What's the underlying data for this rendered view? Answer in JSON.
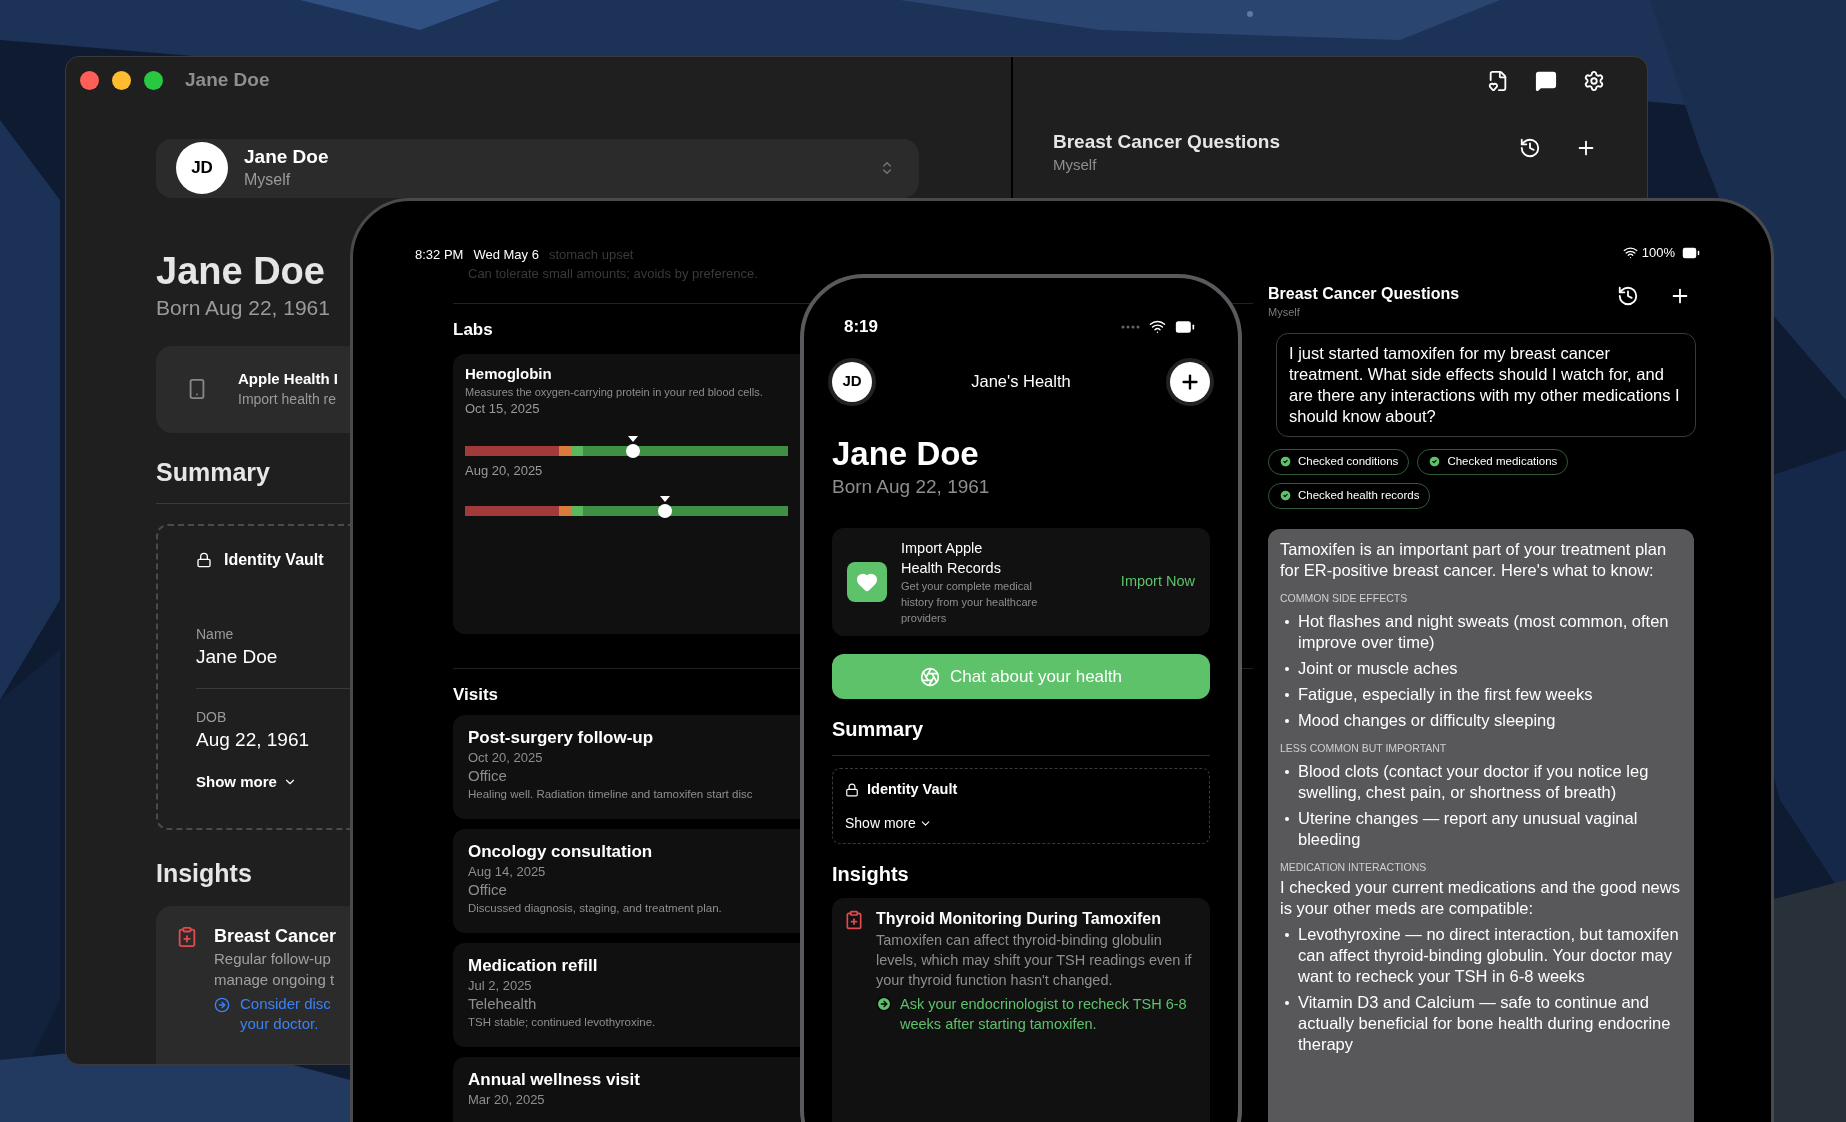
{
  "desktop_window": {
    "title": "Jane Doe",
    "profile": {
      "initials": "JD",
      "name": "Jane Doe",
      "relation": "Myself"
    },
    "name": "Jane Doe",
    "born": "Born Aug 22, 1961",
    "import_card": {
      "title": "Apple Health I",
      "subtitle": "Import health re"
    },
    "summary_heading": "Summary",
    "identity_vault": {
      "title": "Identity Vault",
      "fields": [
        {
          "label": "Name",
          "value": "Jane Doe"
        },
        {
          "label": "DOB",
          "value": "Aug 22, 1961"
        }
      ],
      "show_more": "Show more"
    },
    "insights_heading": "Insights",
    "insight": {
      "title": "Breast Cancer",
      "body_lines": [
        "Regular follow-up",
        "manage ongoing t"
      ],
      "action_lines": [
        "Consider disc",
        "your doctor."
      ]
    },
    "chat": {
      "title": "Breast Cancer Questions",
      "subtitle": "Myself"
    }
  },
  "tablet": {
    "status": {
      "time": "8:32 PM",
      "date": "Wed May 6",
      "battery": "100%"
    },
    "faded_allergy": {
      "reaction": "stomach upset",
      "note": "Can tolerate small amounts; avoids by preference."
    },
    "labs": {
      "heading": "Labs",
      "items": [
        {
          "name": "Hemoglobin",
          "description": "Measures the oxygen-carrying protein in your red blood cells.",
          "readings": [
            {
              "date": "Oct 15, 2025",
              "level": 0.52
            },
            {
              "date": "Aug 20, 2025",
              "level": 0.62
            }
          ]
        }
      ]
    },
    "visits": {
      "heading": "Visits",
      "items": [
        {
          "title": "Post-surgery follow-up",
          "date": "Oct 20, 2025",
          "type": "Office",
          "note": "Healing well. Radiation timeline and tamoxifen start disc"
        },
        {
          "title": "Oncology consultation",
          "date": "Aug 14, 2025",
          "type": "Office",
          "note": "Discussed diagnosis, staging, and treatment plan."
        },
        {
          "title": "Medication refill",
          "date": "Jul 2, 2025",
          "type": "Telehealth",
          "note": "TSH stable; continued levothyroxine."
        },
        {
          "title": "Annual wellness visit",
          "date": "Mar 20, 2025"
        }
      ]
    },
    "chat": {
      "title": "Breast Cancer Questions",
      "subtitle": "Myself",
      "question": "I just started tamoxifen for my breast cancer treatment. What side effects should I watch for, and are there any interactions with my other medications I should know about?",
      "checks": [
        "Checked conditions",
        "Checked medications",
        "Checked health records"
      ],
      "response": {
        "intro": "Tamoxifen is an important part of your treatment plan for ER-positive breast cancer. Here's what to know:",
        "sections": [
          {
            "heading": "COMMON SIDE EFFECTS",
            "bullets": [
              "Hot flashes and night sweats (most common, often improve over time)",
              "Joint or muscle aches",
              "Fatigue, especially in the first few weeks",
              "Mood changes or difficulty sleeping"
            ]
          },
          {
            "heading": "LESS COMMON BUT IMPORTANT",
            "bullets": [
              "Blood clots (contact your doctor if you notice leg swelling, chest pain, or shortness of breath)",
              "Uterine changes — report any unusual vaginal bleeding"
            ]
          },
          {
            "heading": "MEDICATION INTERACTIONS",
            "text": "I checked your current medications and the good news is your other meds are compatible:",
            "bullets": [
              "Levothyroxine — no direct interaction, but tamoxifen can affect thyroid-binding globulin. Your doctor may want to recheck your TSH in 6-8 weeks",
              "Vitamin D3 and Calcium — safe to continue and actually beneficial for bone health during endocrine therapy"
            ]
          }
        ]
      }
    }
  },
  "phone": {
    "time": "8:19",
    "initials": "JD",
    "title": "Jane's Health",
    "name": "Jane Doe",
    "born": "Born Aug 22, 1961",
    "import_card": {
      "title": "Import Apple Health Records",
      "subtitle": "Get your complete medical history from your healthcare providers",
      "action": "Import Now"
    },
    "chat_button": "Chat about your health",
    "summary_heading": "Summary",
    "identity_vault": {
      "title": "Identity Vault",
      "show_more": "Show more"
    },
    "insights_heading": "Insights",
    "insight": {
      "title": "Thyroid Monitoring During Tamoxifen",
      "body": "Tamoxifen can affect thyroid-binding globulin levels, which may shift your TSH readings even if your thyroid function hasn't changed.",
      "action": "Ask your endocrinologist to recheck TSH 6-8 weeks after starting tamoxifen."
    }
  }
}
